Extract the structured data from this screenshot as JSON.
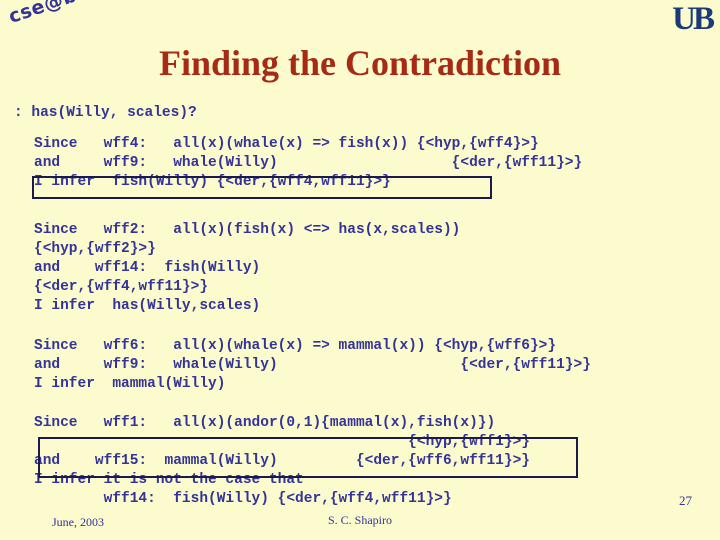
{
  "header": {
    "cse_logo_text": "cse@buffalo",
    "ub_logo_text": "UB"
  },
  "title": "Finding the Contradiction",
  "prompt_line": ": has(Willy, scales)?",
  "blocks": {
    "block1": "Since   wff4:   all(x)(whale(x) => fish(x)) {<hyp,{wff4}>}\nand     wff9:   whale(Willy)                    {<der,{wff11}>}\nI infer  fish(Willy) {<der,{wff4,wff11}>}",
    "block2": "Since   wff2:   all(x)(fish(x) <=> has(x,scales))\n{<hyp,{wff2}>}\nand    wff14:  fish(Willy)\n{<der,{wff4,wff11}>}\nI infer  has(Willy,scales)",
    "block3": "Since   wff6:   all(x)(whale(x) => mammal(x)) {<hyp,{wff6}>}\nand     wff9:   whale(Willy)                     {<der,{wff11}>}\nI infer  mammal(Willy)",
    "block4": "Since   wff1:   all(x)(andor(0,1){mammal(x),fish(x)})\n                                           {<hyp,{wff1}>}\nand    wff15:  mammal(Willy)         {<der,{wff6,wff11}>}\nI infer it is not the case that\n        wff14:  fish(Willy) {<der,{wff4,wff11}>}"
  },
  "footer": {
    "date": "June, 2003",
    "author": "S. C. Shapiro",
    "page_number": "27"
  },
  "colors": {
    "background": "#FBFBCE",
    "title": "#A62A14",
    "body_text": "#333399",
    "box_border": "#1A1A4D",
    "logo": "#1B3A7A"
  }
}
